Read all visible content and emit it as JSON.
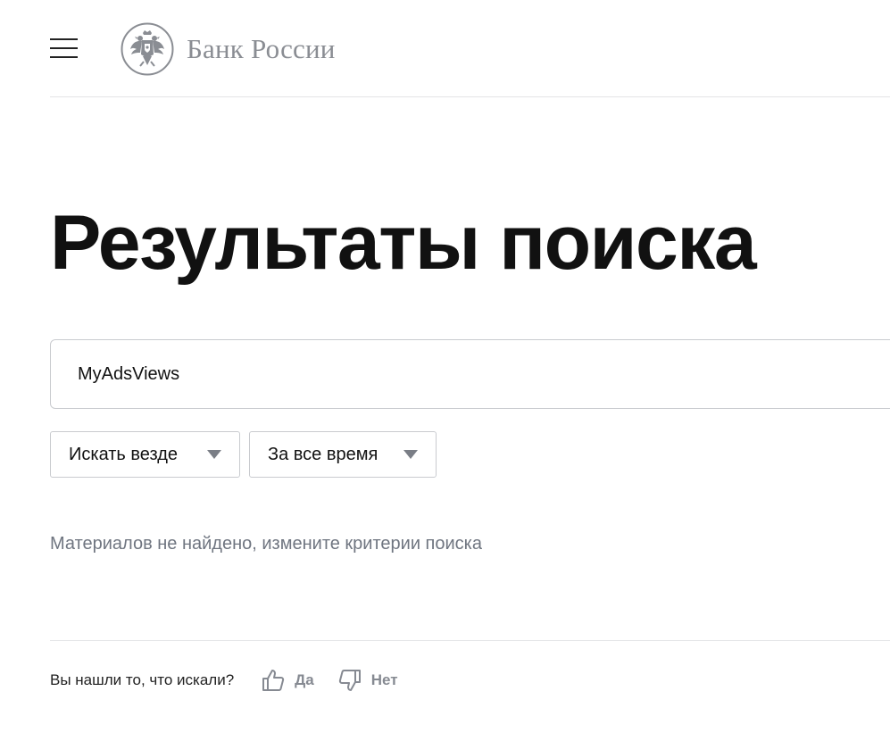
{
  "header": {
    "menu_icon": "hamburger-menu-icon",
    "logo_icon": "double-headed-eagle-emblem",
    "logo_text": "Банк России"
  },
  "main": {
    "title": "Результаты поиска",
    "search": {
      "value": "MyAdsViews",
      "placeholder": ""
    },
    "filters": {
      "scope_label": "Искать везде",
      "period_label": "За все время",
      "arrow_icon": "caret-down-icon"
    },
    "no_results_text": "Материалов не найдено, измените критерии поиска"
  },
  "feedback": {
    "question": "Вы нашли то, что искали?",
    "yes_label": "Да",
    "no_label": "Нет",
    "yes_icon": "thumbs-up-icon",
    "no_icon": "thumbs-down-icon"
  },
  "colors": {
    "title_text": "#111111",
    "logo_text": "#8a8d93",
    "muted_text": "#6f7580",
    "border": "#c9cbcf",
    "divider": "#e3e4e6"
  }
}
